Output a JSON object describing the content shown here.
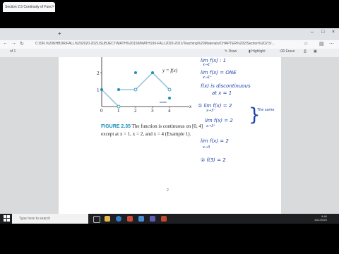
{
  "browser": {
    "tab_title": "Section 2.5 Continuity of Func",
    "url": "C:/DR.%20NHBDR/FALL%202020-2021/SUBJECT/MATH%20199/MATH199-FALL2020-2021/Teaching%20Materials/CHAPTER%202/Section%202.5/...",
    "page_of": "of 1",
    "tool_draw": "Draw",
    "tool_highlight": "Highlight",
    "tool_erase": "Erase"
  },
  "figure": {
    "y_tick_1": "1",
    "y_tick_2": "2",
    "x_tick_0": "0",
    "x_tick_1": "1",
    "x_tick_2": "2",
    "x_tick_3": "3",
    "x_tick_4": "4",
    "x_axis_label": "x",
    "function_label": "y = f(x)",
    "caption_fig": "FIGURE 2.35",
    "caption_text": "The function is continuous on [0, 4] except at x = 1, x = 2, and x = 4 (Example 1)."
  },
  "notes": {
    "line1": "lim f(x) : 1",
    "line1_sub": "x→1⁻",
    "line2": "lim f(x) = ONE",
    "line2_sub": "x→1⁺",
    "line3": "f(x) is discontinuous",
    "line4": "at x = 1",
    "item1": "① lim f(x) = 2",
    "item1_sub": "x→3⁻",
    "item1b": "lim f(x) = 2",
    "item1b_sub": "x→3⁺",
    "bracket_note": "The same",
    "item1c": "lim f(x) = 2",
    "item1c_sub": "x→3",
    "item2": "② f(3) = 2"
  },
  "page_number": "2",
  "taskbar": {
    "search_placeholder": "Type here to search",
    "time": "9:48",
    "date": "10/1/2020"
  }
}
